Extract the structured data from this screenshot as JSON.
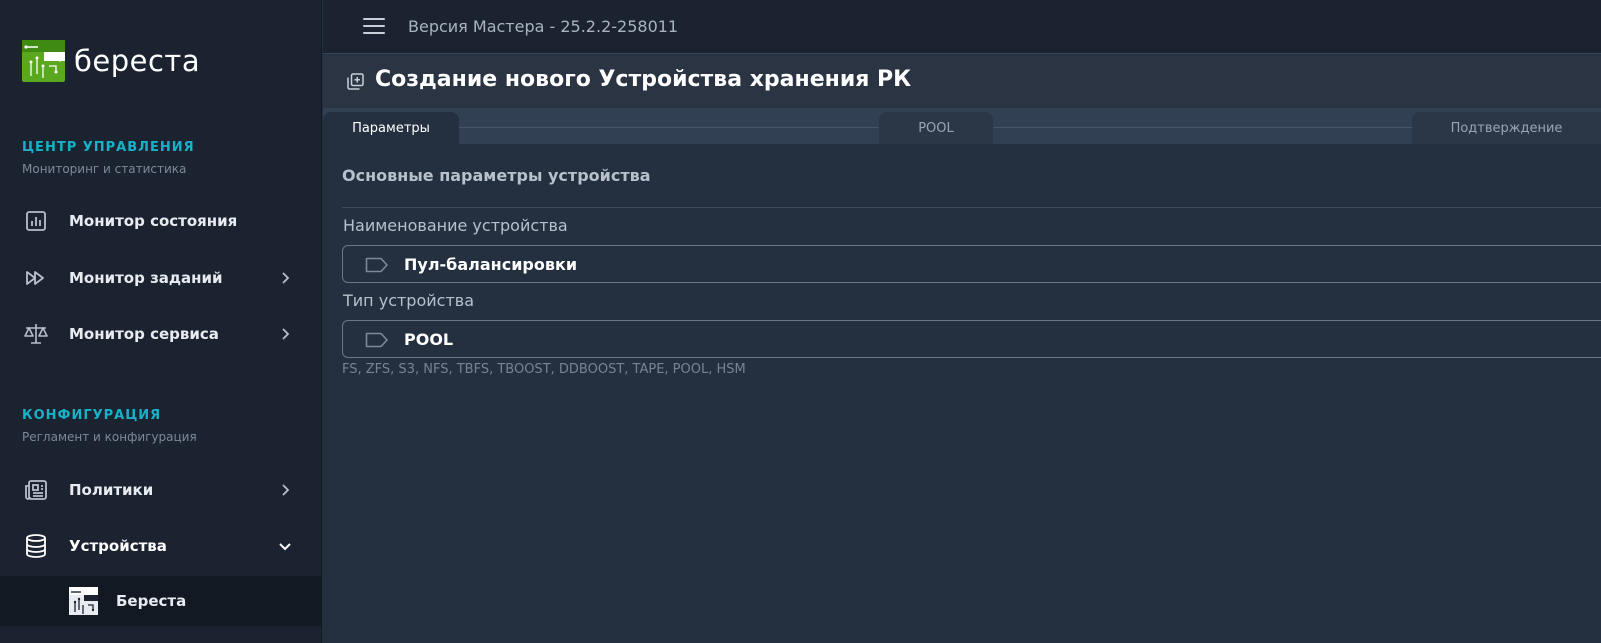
{
  "brand": {
    "name": "береста"
  },
  "sidebar": {
    "sections": [
      {
        "title": "ЦЕНТР УПРАВЛЕНИЯ",
        "subtitle": "Мониторинг и статистика"
      },
      {
        "title": "КОНФИГУРАЦИЯ",
        "subtitle": "Регламент и конфигурация"
      }
    ],
    "items": [
      {
        "label": "Монитор состояния",
        "icon": "chart-icon"
      },
      {
        "label": "Монитор заданий",
        "icon": "fast-forward-icon"
      },
      {
        "label": "Монитор сервиса",
        "icon": "scales-icon"
      },
      {
        "label": "Политики",
        "icon": "newspaper-icon"
      },
      {
        "label": "Устройства",
        "icon": "database-icon"
      }
    ],
    "subitem": {
      "label": "Береста",
      "icon": "beresta-logo-icon"
    }
  },
  "topbar": {
    "version": "Версия Мастера - 25.2.2-258011"
  },
  "page": {
    "title": "Создание нового Устройства хранения РК"
  },
  "steps": [
    {
      "label": "Параметры",
      "active": true
    },
    {
      "label": "POOL",
      "active": false
    },
    {
      "label": "Подтверждение",
      "active": false
    }
  ],
  "form": {
    "group_title": "Основные параметры устройства",
    "name_label": "Наименование устройства",
    "name_value": "Пул-балансировки",
    "type_label": "Тип устройства",
    "type_value": "POOL",
    "type_hint": "FS, ZFS, S3, NFS, TBFS, TBOOST, DDBOOST, TAPE, POOL, HSM"
  },
  "colors": {
    "accent": "#17b2c7",
    "brand_green": "#5aa81e",
    "sidebar_bg": "#1b2331",
    "content_bg": "#243040"
  }
}
